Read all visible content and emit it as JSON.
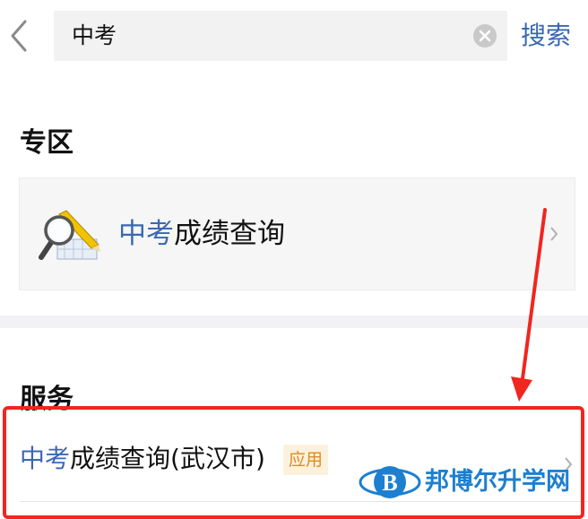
{
  "search": {
    "query": "中考",
    "button_label": "搜索"
  },
  "zone": {
    "title": "专区",
    "card": {
      "highlight": "中考",
      "rest": "成绩查询"
    }
  },
  "services": {
    "title": "服务",
    "item": {
      "highlight": "中考",
      "rest": "成绩查询(武汉市)",
      "badge": "应用"
    }
  },
  "watermark": {
    "text": "邦博尔升学网",
    "logo_letter": "B"
  },
  "colors": {
    "highlight": "#3a68b3",
    "annotation_red": "#f0261f",
    "badge_text": "#e08a1e",
    "badge_bg": "#fcf1dc"
  }
}
